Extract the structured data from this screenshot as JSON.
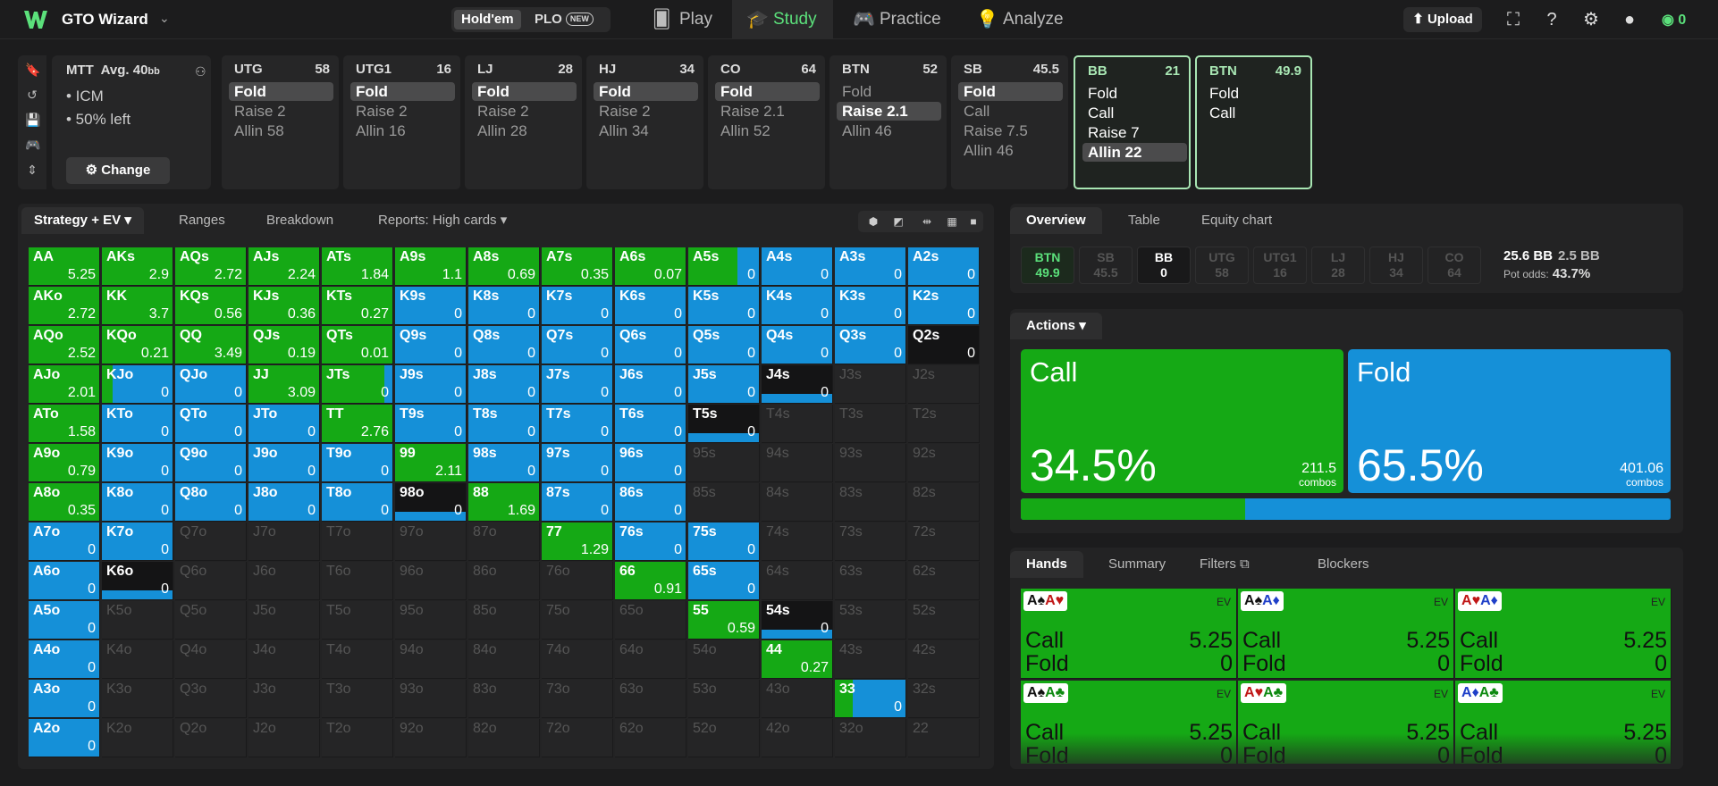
{
  "header": {
    "brand": "GTO Wizard",
    "game_holdem": "Hold'em",
    "game_plo": "PLO",
    "new_badge": "NEW",
    "nav": [
      {
        "label": "Play",
        "icon": "cards-icon"
      },
      {
        "label": "Study",
        "icon": "graduation-cap-icon"
      },
      {
        "label": "Practice",
        "icon": "gamepad-icon"
      },
      {
        "label": "Analyze",
        "icon": "lightbulb-icon"
      }
    ],
    "upload": "Upload",
    "wallet": "0"
  },
  "mtt": {
    "title": "MTT",
    "avg": "Avg. 40",
    "avg_unit": "bb",
    "line1": "• ICM",
    "line2": "• 50% left",
    "change": "Change"
  },
  "positions": [
    {
      "name": "UTG",
      "stack": "58",
      "actions": [
        "Fold",
        "Raise 2",
        "Allin 58"
      ],
      "selected": 0
    },
    {
      "name": "UTG1",
      "stack": "16",
      "actions": [
        "Fold",
        "Raise 2",
        "Allin 16"
      ],
      "selected": 0
    },
    {
      "name": "LJ",
      "stack": "28",
      "actions": [
        "Fold",
        "Raise 2",
        "Allin 28"
      ],
      "selected": 0
    },
    {
      "name": "HJ",
      "stack": "34",
      "actions": [
        "Fold",
        "Raise 2",
        "Allin 34"
      ],
      "selected": 0
    },
    {
      "name": "CO",
      "stack": "64",
      "actions": [
        "Fold",
        "Raise 2.1",
        "Allin 52"
      ],
      "selected": 0
    },
    {
      "name": "BTN",
      "stack": "52",
      "actions": [
        "Fold",
        "Raise 2.1",
        "Allin 46"
      ],
      "selected": 1
    },
    {
      "name": "SB",
      "stack": "45.5",
      "actions": [
        "Fold",
        "Call",
        "Raise 7.5",
        "Allin 46"
      ],
      "selected": 0
    },
    {
      "name": "BB",
      "stack": "21",
      "actions": [
        "Fold",
        "Call",
        "Raise 7",
        "Allin 22"
      ],
      "selected": 3,
      "active": true
    },
    {
      "name": "BTN",
      "stack": "49.9",
      "actions": [
        "Fold",
        "Call"
      ],
      "selected": -1,
      "active": true
    }
  ],
  "left_tabs": [
    "Strategy + EV",
    "Ranges",
    "Breakdown",
    "Reports: High cards"
  ],
  "colors": {
    "call": "#15a915",
    "fold": "#1590d8",
    "accent": "#5be07b"
  },
  "matrix": {
    "ranks": [
      "A",
      "K",
      "Q",
      "J",
      "T",
      "9",
      "8",
      "7",
      "6",
      "5",
      "4",
      "3",
      "2"
    ],
    "cells": [
      [
        [
          "AA",
          "5.25",
          100
        ],
        [
          "AKs",
          "2.9",
          100
        ],
        [
          "AQs",
          "2.72",
          100
        ],
        [
          "AJs",
          "2.24",
          100
        ],
        [
          "ATs",
          "1.84",
          100
        ],
        [
          "A9s",
          "1.1",
          100
        ],
        [
          "A8s",
          "0.69",
          100
        ],
        [
          "A7s",
          "0.35",
          100
        ],
        [
          "A6s",
          "0.07",
          100
        ],
        [
          "A5s",
          "0",
          70
        ],
        [
          "A4s",
          "0",
          0
        ],
        [
          "A3s",
          "0",
          0
        ],
        [
          "A2s",
          "0",
          0
        ]
      ],
      [
        [
          "AKo",
          "2.72",
          100
        ],
        [
          "KK",
          "3.7",
          100
        ],
        [
          "KQs",
          "0.56",
          100
        ],
        [
          "KJs",
          "0.36",
          100
        ],
        [
          "KTs",
          "0.27",
          100
        ],
        [
          "K9s",
          "0",
          0
        ],
        [
          "K8s",
          "0",
          0
        ],
        [
          "K7s",
          "0",
          0
        ],
        [
          "K6s",
          "0",
          0
        ],
        [
          "K5s",
          "0",
          0
        ],
        [
          "K4s",
          "0",
          0
        ],
        [
          "K3s",
          "0",
          0
        ],
        [
          "K2s",
          "0",
          0
        ]
      ],
      [
        [
          "AQo",
          "2.52",
          100
        ],
        [
          "KQo",
          "0.21",
          100
        ],
        [
          "QQ",
          "3.49",
          100
        ],
        [
          "QJs",
          "0.19",
          100
        ],
        [
          "QTs",
          "0.01",
          100
        ],
        [
          "Q9s",
          "0",
          0
        ],
        [
          "Q8s",
          "0",
          0
        ],
        [
          "Q7s",
          "0",
          0
        ],
        [
          "Q6s",
          "0",
          0
        ],
        [
          "Q5s",
          "0",
          0
        ],
        [
          "Q4s",
          "0",
          0
        ],
        [
          "Q3s",
          "0",
          0
        ],
        [
          "Q2s",
          "0",
          "dark"
        ]
      ],
      [
        [
          "AJo",
          "2.01",
          100
        ],
        [
          "KJo",
          "0",
          15
        ],
        [
          "QJo",
          "0",
          0
        ],
        [
          "JJ",
          "3.09",
          100
        ],
        [
          "JTs",
          "0",
          88
        ],
        [
          "J9s",
          "0",
          0
        ],
        [
          "J8s",
          "0",
          0
        ],
        [
          "J7s",
          "0",
          0
        ],
        [
          "J6s",
          "0",
          0
        ],
        [
          "J5s",
          "0",
          0
        ],
        [
          "J4s",
          "0",
          "partial"
        ],
        [
          "J3s",
          "",
          "empty"
        ],
        [
          "J2s",
          "",
          "empty"
        ]
      ],
      [
        [
          "ATo",
          "1.58",
          100
        ],
        [
          "KTo",
          "0",
          0
        ],
        [
          "QTo",
          "0",
          0
        ],
        [
          "JTo",
          "0",
          0
        ],
        [
          "TT",
          "2.76",
          100
        ],
        [
          "T9s",
          "0",
          0
        ],
        [
          "T8s",
          "0",
          0
        ],
        [
          "T7s",
          "0",
          0
        ],
        [
          "T6s",
          "0",
          0
        ],
        [
          "T5s",
          "0",
          "partial"
        ],
        [
          "T4s",
          "",
          "empty"
        ],
        [
          "T3s",
          "",
          "empty"
        ],
        [
          "T2s",
          "",
          "empty"
        ]
      ],
      [
        [
          "A9o",
          "0.79",
          100
        ],
        [
          "K9o",
          "0",
          0
        ],
        [
          "Q9o",
          "0",
          0
        ],
        [
          "J9o",
          "0",
          0
        ],
        [
          "T9o",
          "0",
          0
        ],
        [
          "99",
          "2.11",
          100
        ],
        [
          "98s",
          "0",
          0
        ],
        [
          "97s",
          "0",
          0
        ],
        [
          "96s",
          "0",
          0
        ],
        [
          "95s",
          "",
          "empty"
        ],
        [
          "94s",
          "",
          "empty"
        ],
        [
          "93s",
          "",
          "empty"
        ],
        [
          "92s",
          "",
          "empty"
        ]
      ],
      [
        [
          "A8o",
          "0.35",
          100
        ],
        [
          "K8o",
          "0",
          0
        ],
        [
          "Q8o",
          "0",
          0
        ],
        [
          "J8o",
          "0",
          0
        ],
        [
          "T8o",
          "0",
          0
        ],
        [
          "98o",
          "0",
          "partial"
        ],
        [
          "88",
          "1.69",
          100
        ],
        [
          "87s",
          "0",
          0
        ],
        [
          "86s",
          "0",
          0
        ],
        [
          "85s",
          "",
          "empty"
        ],
        [
          "84s",
          "",
          "empty"
        ],
        [
          "83s",
          "",
          "empty"
        ],
        [
          "82s",
          "",
          "empty"
        ]
      ],
      [
        [
          "A7o",
          "0",
          0
        ],
        [
          "K7o",
          "0",
          0
        ],
        [
          "Q7o",
          "",
          "empty"
        ],
        [
          "J7o",
          "",
          "empty"
        ],
        [
          "T7o",
          "",
          "empty"
        ],
        [
          "97o",
          "",
          "empty"
        ],
        [
          "87o",
          "",
          "empty"
        ],
        [
          "77",
          "1.29",
          100
        ],
        [
          "76s",
          "0",
          0
        ],
        [
          "75s",
          "0",
          0
        ],
        [
          "74s",
          "",
          "empty"
        ],
        [
          "73s",
          "",
          "empty"
        ],
        [
          "72s",
          "",
          "empty"
        ]
      ],
      [
        [
          "A6o",
          "0",
          0
        ],
        [
          "K6o",
          "0",
          "partial"
        ],
        [
          "Q6o",
          "",
          "empty"
        ],
        [
          "J6o",
          "",
          "empty"
        ],
        [
          "T6o",
          "",
          "empty"
        ],
        [
          "96o",
          "",
          "empty"
        ],
        [
          "86o",
          "",
          "empty"
        ],
        [
          "76o",
          "",
          "empty"
        ],
        [
          "66",
          "0.91",
          100
        ],
        [
          "65s",
          "0",
          0
        ],
        [
          "64s",
          "",
          "empty"
        ],
        [
          "63s",
          "",
          "empty"
        ],
        [
          "62s",
          "",
          "empty"
        ]
      ],
      [
        [
          "A5o",
          "0",
          0
        ],
        [
          "K5o",
          "",
          "empty"
        ],
        [
          "Q5o",
          "",
          "empty"
        ],
        [
          "J5o",
          "",
          "empty"
        ],
        [
          "T5o",
          "",
          "empty"
        ],
        [
          "95o",
          "",
          "empty"
        ],
        [
          "85o",
          "",
          "empty"
        ],
        [
          "75o",
          "",
          "empty"
        ],
        [
          "65o",
          "",
          "empty"
        ],
        [
          "55",
          "0.59",
          100
        ],
        [
          "54s",
          "0",
          "partial"
        ],
        [
          "53s",
          "",
          "empty"
        ],
        [
          "52s",
          "",
          "empty"
        ]
      ],
      [
        [
          "A4o",
          "0",
          0
        ],
        [
          "K4o",
          "",
          "empty"
        ],
        [
          "Q4o",
          "",
          "empty"
        ],
        [
          "J4o",
          "",
          "empty"
        ],
        [
          "T4o",
          "",
          "empty"
        ],
        [
          "94o",
          "",
          "empty"
        ],
        [
          "84o",
          "",
          "empty"
        ],
        [
          "74o",
          "",
          "empty"
        ],
        [
          "64o",
          "",
          "empty"
        ],
        [
          "54o",
          "",
          "empty"
        ],
        [
          "44",
          "0.27",
          100
        ],
        [
          "43s",
          "",
          "empty"
        ],
        [
          "42s",
          "",
          "empty"
        ]
      ],
      [
        [
          "A3o",
          "0",
          0
        ],
        [
          "K3o",
          "",
          "empty"
        ],
        [
          "Q3o",
          "",
          "empty"
        ],
        [
          "J3o",
          "",
          "empty"
        ],
        [
          "T3o",
          "",
          "empty"
        ],
        [
          "93o",
          "",
          "empty"
        ],
        [
          "83o",
          "",
          "empty"
        ],
        [
          "73o",
          "",
          "empty"
        ],
        [
          "63o",
          "",
          "empty"
        ],
        [
          "53o",
          "",
          "empty"
        ],
        [
          "43o",
          "",
          "empty"
        ],
        [
          "33",
          "0",
          25
        ],
        [
          "32s",
          "",
          "empty"
        ]
      ],
      [
        [
          "A2o",
          "0",
          0
        ],
        [
          "K2o",
          "",
          "empty"
        ],
        [
          "Q2o",
          "",
          "empty"
        ],
        [
          "J2o",
          "",
          "empty"
        ],
        [
          "T2o",
          "",
          "empty"
        ],
        [
          "92o",
          "",
          "empty"
        ],
        [
          "82o",
          "",
          "empty"
        ],
        [
          "72o",
          "",
          "empty"
        ],
        [
          "62o",
          "",
          "empty"
        ],
        [
          "52o",
          "",
          "empty"
        ],
        [
          "42o",
          "",
          "empty"
        ],
        [
          "32o",
          "",
          "empty"
        ],
        [
          "22",
          "",
          "empty"
        ]
      ]
    ]
  },
  "right_tabs": [
    "Overview",
    "Table",
    "Equity chart"
  ],
  "overview": {
    "positions": [
      {
        "name": "BTN",
        "stack": "49.9",
        "style": "g"
      },
      {
        "name": "SB",
        "stack": "45.5",
        "style": ""
      },
      {
        "name": "BB",
        "stack": "0",
        "style": "w"
      },
      {
        "name": "UTG",
        "stack": "58",
        "style": ""
      },
      {
        "name": "UTG1",
        "stack": "16",
        "style": ""
      },
      {
        "name": "LJ",
        "stack": "28",
        "style": ""
      },
      {
        "name": "HJ",
        "stack": "34",
        "style": ""
      },
      {
        "name": "CO",
        "stack": "64",
        "style": ""
      }
    ],
    "pot": "25.6 BB",
    "to_call": "2.5 BB",
    "pot_odds_label": "Pot odds:",
    "pot_odds": "43.7%"
  },
  "actions": {
    "tab": "Actions",
    "call": {
      "label": "Call",
      "pct": "34.5%",
      "combos": "211.5",
      "combos_label": "combos",
      "fraction": 0.345
    },
    "fold": {
      "label": "Fold",
      "pct": "65.5%",
      "combos": "401.06",
      "combos_label": "combos"
    }
  },
  "hands_tabs": [
    "Hands",
    "Summary",
    "Filters",
    "Blockers"
  ],
  "hands": [
    {
      "r1": "A",
      "s1": "♠",
      "c1": "s",
      "r2": "A",
      "s2": "♥",
      "c2": "h",
      "call": "5.25",
      "fold": "0"
    },
    {
      "r1": "A",
      "s1": "♠",
      "c1": "s",
      "r2": "A",
      "s2": "♦",
      "c2": "d",
      "call": "5.25",
      "fold": "0"
    },
    {
      "r1": "A",
      "s1": "♥",
      "c1": "h",
      "r2": "A",
      "s2": "♦",
      "c2": "d",
      "call": "5.25",
      "fold": "0"
    },
    {
      "r1": "A",
      "s1": "♠",
      "c1": "s",
      "r2": "A",
      "s2": "♣",
      "c2": "c",
      "call": "5.25",
      "fold": "0"
    },
    {
      "r1": "A",
      "s1": "♥",
      "c1": "h",
      "r2": "A",
      "s2": "♣",
      "c2": "c",
      "call": "5.25",
      "fold": "0"
    },
    {
      "r1": "A",
      "s1": "♦",
      "c1": "d",
      "r2": "A",
      "s2": "♣",
      "c2": "c",
      "call": "5.25",
      "fold": "0"
    }
  ],
  "hand_labels": {
    "ev": "EV",
    "call": "Call",
    "fold": "Fold"
  }
}
